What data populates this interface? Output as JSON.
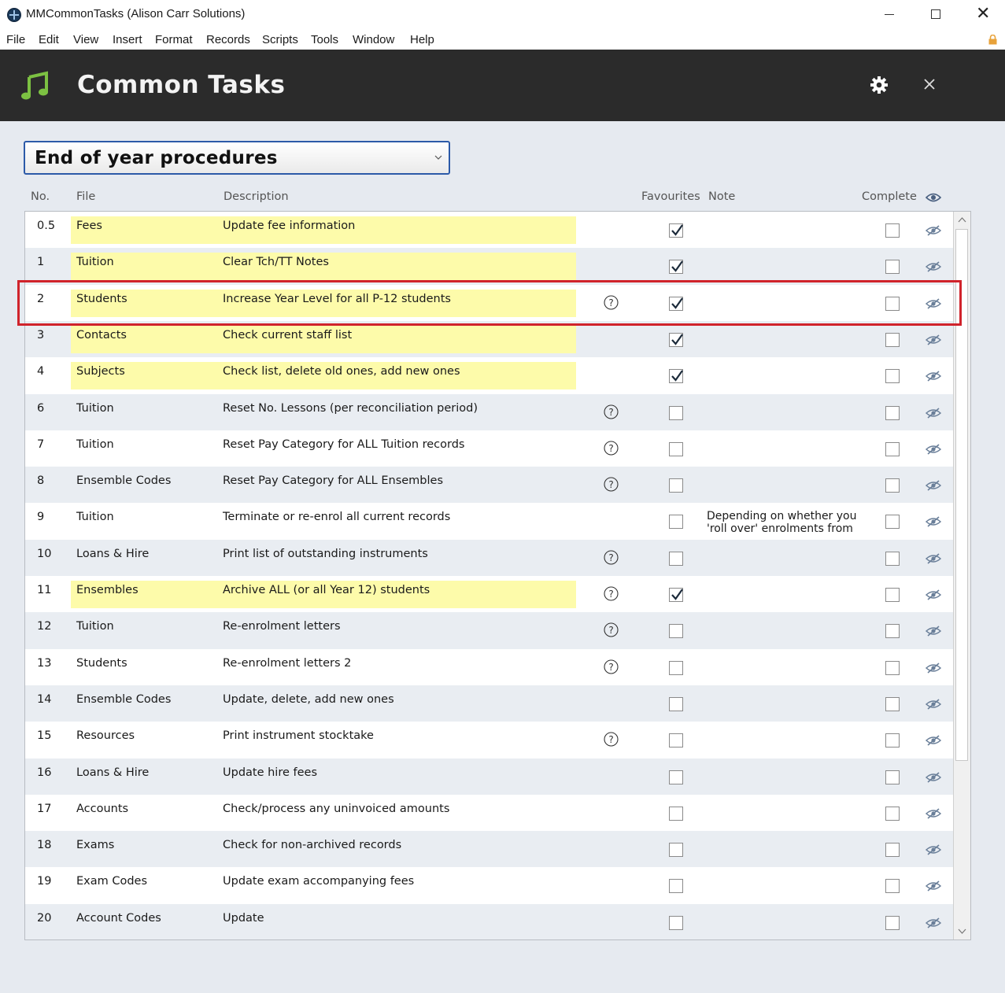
{
  "window": {
    "title": "MMCommonTasks (Alison Carr Solutions)",
    "minimize": "–",
    "maximize": "□",
    "close": "✕"
  },
  "menu": [
    "File",
    "Edit",
    "View",
    "Insert",
    "Format",
    "Records",
    "Scripts",
    "Tools",
    "Window",
    "Help"
  ],
  "header": {
    "title": "Common Tasks",
    "icon": "music-note-icon",
    "accent_color": "#7cc142"
  },
  "dropdown": {
    "selected": "End of year procedures"
  },
  "columns": {
    "no": "No.",
    "file": "File",
    "description": "Description",
    "favourites": "Favourites",
    "note": "Note",
    "complete": "Complete"
  },
  "rows": [
    {
      "no": "0.5",
      "file": "Fees",
      "description": "Update fee information",
      "highlight": true,
      "help": false,
      "favourite": true,
      "note": "",
      "complete": false
    },
    {
      "no": "1",
      "file": "Tuition",
      "description": "Clear Tch/TT Notes",
      "highlight": true,
      "help": false,
      "favourite": true,
      "note": "",
      "complete": false
    },
    {
      "no": "2",
      "file": "Students",
      "description": "Increase Year Level for all P-12 students",
      "highlight": true,
      "help": true,
      "favourite": true,
      "note": "",
      "complete": false
    },
    {
      "no": "3",
      "file": "Contacts",
      "description": "Check current staff list",
      "highlight": true,
      "help": false,
      "favourite": true,
      "note": "",
      "complete": false
    },
    {
      "no": "4",
      "file": "Subjects",
      "description": "Check list, delete old ones, add new ones",
      "highlight": true,
      "help": false,
      "favourite": true,
      "note": "",
      "complete": false
    },
    {
      "no": "6",
      "file": "Tuition",
      "description": "Reset No. Lessons (per reconciliation period)",
      "highlight": false,
      "help": true,
      "favourite": false,
      "note": "",
      "complete": false
    },
    {
      "no": "7",
      "file": "Tuition",
      "description": "Reset Pay Category for ALL Tuition records",
      "highlight": false,
      "help": true,
      "favourite": false,
      "note": "",
      "complete": false
    },
    {
      "no": "8",
      "file": "Ensemble Codes",
      "description": "Reset Pay Category for ALL Ensembles",
      "highlight": false,
      "help": true,
      "favourite": false,
      "note": "",
      "complete": false
    },
    {
      "no": "9",
      "file": "Tuition",
      "description": "Terminate or re-enrol all current records",
      "highlight": false,
      "help": false,
      "favourite": false,
      "note": "Depending on whether you 'roll over' enrolments from",
      "complete": false
    },
    {
      "no": "10",
      "file": "Loans & Hire",
      "description": "Print list of outstanding instruments",
      "highlight": false,
      "help": true,
      "favourite": false,
      "note": "",
      "complete": false
    },
    {
      "no": "11",
      "file": "Ensembles",
      "description": "Archive ALL (or all Year 12) students",
      "highlight": true,
      "help": true,
      "favourite": true,
      "note": "",
      "complete": false
    },
    {
      "no": "12",
      "file": "Tuition",
      "description": "Re-enrolment letters",
      "highlight": false,
      "help": true,
      "favourite": false,
      "note": "",
      "complete": false
    },
    {
      "no": "13",
      "file": "Students",
      "description": "Re-enrolment letters 2",
      "highlight": false,
      "help": true,
      "favourite": false,
      "note": "",
      "complete": false
    },
    {
      "no": "14",
      "file": "Ensemble Codes",
      "description": "Update, delete, add new ones",
      "highlight": false,
      "help": false,
      "favourite": false,
      "note": "",
      "complete": false
    },
    {
      "no": "15",
      "file": "Resources",
      "description": "Print instrument stocktake",
      "highlight": false,
      "help": true,
      "favourite": false,
      "note": "",
      "complete": false
    },
    {
      "no": "16",
      "file": "Loans & Hire",
      "description": "Update hire fees",
      "highlight": false,
      "help": false,
      "favourite": false,
      "note": "",
      "complete": false
    },
    {
      "no": "17",
      "file": "Accounts",
      "description": "Check/process any uninvoiced amounts",
      "highlight": false,
      "help": false,
      "favourite": false,
      "note": "",
      "complete": false
    },
    {
      "no": "18",
      "file": "Exams",
      "description": "Check for non-archived records",
      "highlight": false,
      "help": false,
      "favourite": false,
      "note": "",
      "complete": false
    },
    {
      "no": "19",
      "file": "Exam Codes",
      "description": "Update exam accompanying fees",
      "highlight": false,
      "help": false,
      "favourite": false,
      "note": "",
      "complete": false
    },
    {
      "no": "20",
      "file": "Account Codes",
      "description": "Update",
      "highlight": false,
      "help": false,
      "favourite": false,
      "note": "",
      "complete": false
    }
  ],
  "colors": {
    "highlight": "#fdfbaa",
    "selection_border": "#d0232b",
    "header_bg": "#2b2b2b"
  }
}
